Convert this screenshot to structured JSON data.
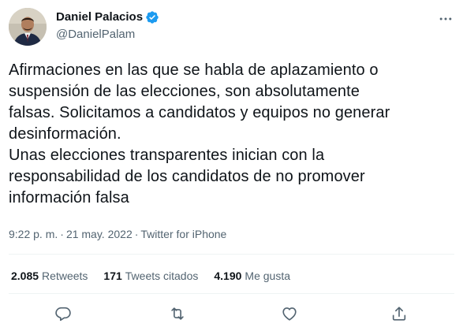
{
  "author": {
    "display_name": "Daniel Palacios",
    "handle": "@DanielPalam",
    "verified": true
  },
  "tweet": {
    "text": "Afirmaciones en las que se habla de aplazamiento o\nsuspensión de las elecciones, son absolutamente\nfalsas. Solicitamos a candidatos y equipos no generar\ndesinformación.\nUnas elecciones transparentes inician con la\nresponsabilidad de los candidatos de no promover\ninformación falsa",
    "time": "9:22 p. m.",
    "separator": "·",
    "date": "21 may. 2022",
    "source": "Twitter for iPhone"
  },
  "stats": {
    "retweets_count": "2.085",
    "retweets_label": "Retweets",
    "quotes_count": "171",
    "quotes_label": "Tweets citados",
    "likes_count": "4.190",
    "likes_label": "Me gusta"
  },
  "actions": [
    "reply-icon",
    "retweet-icon",
    "like-icon",
    "share-icon",
    "more-icon"
  ],
  "colors": {
    "text": "#0f1419",
    "secondary": "#536471",
    "verified": "#1d9bf0",
    "divider": "#eff3f4"
  }
}
